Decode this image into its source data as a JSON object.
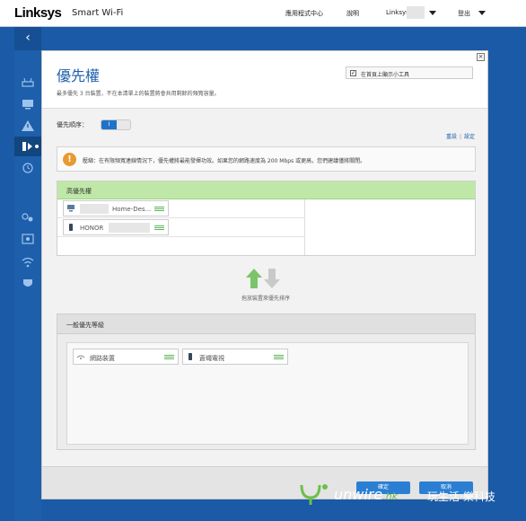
{
  "header": {
    "logo": "Linksys",
    "product": "Smart Wi-Fi",
    "nav_apps": "應用程式中心",
    "nav_help": "說明",
    "nav_account": "Linksys",
    "nav_logout": "登出"
  },
  "sidebar": {
    "back_label": "‹",
    "items": [
      {
        "icon": "router-icon"
      },
      {
        "icon": "devices-icon"
      },
      {
        "icon": "warning-icon"
      },
      {
        "icon": "media-prioritization-icon"
      },
      {
        "icon": "clock-icon"
      },
      {
        "icon": "connectivity-icon"
      },
      {
        "icon": "storage-icon"
      },
      {
        "icon": "wireless-icon"
      },
      {
        "icon": "security-icon"
      }
    ]
  },
  "dialog": {
    "close": "×",
    "title": "優先權",
    "description": "最多優先 3 台裝置，不在本清單上的裝置將會共用剩餘的頻寬容量。",
    "widget_label": "在首頁上顯示小工具",
    "widget_checked": "✓",
    "order_label": "優先順序：",
    "toggle_state": "I",
    "link_reset": "重設",
    "link_settings": "設定",
    "warning_icon": "!",
    "warning_text": "壓縮：在有限頻寬連線情況下，優先權將最能發揮功效。如果您的網路速度為 200 Mbps 或更高，您們建議僅將關閉。",
    "high_priority": {
      "title": "高優先權",
      "devices": [
        {
          "name": "Home-Des...",
          "icon": "desktop-icon"
        },
        {
          "name": "HONOR",
          "icon": "phone-icon"
        }
      ]
    },
    "move_hint": "拖放裝置來優先排序",
    "normal_priority": {
      "title": "一般優先等級",
      "devices": [
        {
          "name": "網路裝置",
          "icon": "network-device-icon"
        },
        {
          "name": "蒼蠅電視",
          "icon": "phone-icon"
        }
      ]
    },
    "ok_label": "確定",
    "cancel_label": "取消"
  },
  "watermark": {
    "brand": "unwire",
    "ext": ".hk",
    "slogan": "玩生活‧樂科技"
  },
  "colors": {
    "accent": "#1d5fab",
    "high_priority_header": "#bfe8a8",
    "warning": "#e89a2e",
    "drag_grip": "#5cb85c"
  }
}
